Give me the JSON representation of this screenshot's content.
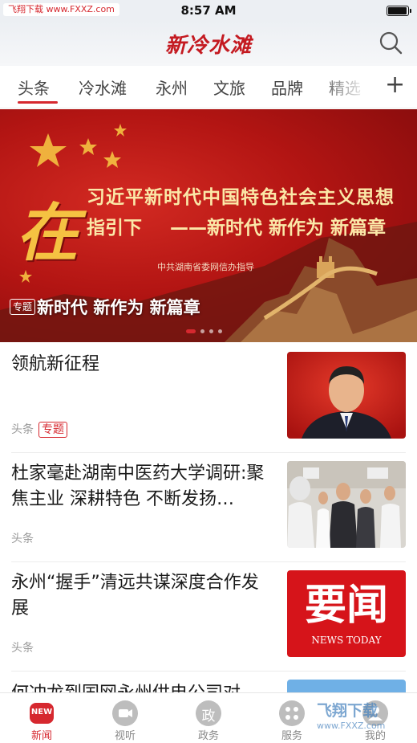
{
  "status_bar": {
    "watermark": "飞翔下载 www.FXXZ.com",
    "time": "8:57 AM",
    "battery_level": 0.95
  },
  "header": {
    "logo": "新冷水滩",
    "search_icon": "search-icon"
  },
  "tabs": {
    "items": [
      "头条",
      "冷水滩",
      "永州",
      "文旅",
      "品牌",
      "精选"
    ],
    "active_index": 0,
    "more_symbol": "+"
  },
  "banner": {
    "big_char": "在",
    "line1": "习近平新时代中国特色社会主义思想",
    "line2a": "指引下",
    "line2b": "——新时代 新作为 新篇章",
    "sub": "中共湖南省委网信办指导",
    "badge": "专题",
    "caption": "新时代 新作为 新篇章",
    "slide_count": 4,
    "active_slide": 0
  },
  "news": [
    {
      "title": "领航新征程",
      "source": "头条",
      "tag": "专题",
      "thumb": "portrait-photo"
    },
    {
      "title": "杜家毫赴湖南中医药大学调研:聚焦主业 深耕特色 不断发扬…",
      "source": "头条",
      "tag": "",
      "thumb": "meeting-photo"
    },
    {
      "title": "永州“握手”清远共谋深度合作发展",
      "source": "头条",
      "tag": "",
      "thumb": "yaowen-logo",
      "thumb_text": "要闻",
      "thumb_sub": "NEWS TODAY"
    },
    {
      "title": "何冲龙到国网永州供电公司对…",
      "source": "",
      "tag": "",
      "thumb": "power-tower-photo"
    }
  ],
  "tabbar": {
    "items": [
      {
        "label": "新闻",
        "icon": "news-icon",
        "badge": "NEW"
      },
      {
        "label": "视听",
        "icon": "video-icon"
      },
      {
        "label": "政务",
        "icon": "government-icon",
        "glyph": "政"
      },
      {
        "label": "服务",
        "icon": "service-icon"
      },
      {
        "label": "我的",
        "icon": "profile-icon"
      }
    ],
    "active_index": 0
  },
  "watermark_bottom": {
    "title": "飞翔下载",
    "url": "www.FXXZ.com"
  },
  "colors": {
    "accent": "#d6282f",
    "banner_red": "#b31513",
    "gold": "#f5c242"
  }
}
